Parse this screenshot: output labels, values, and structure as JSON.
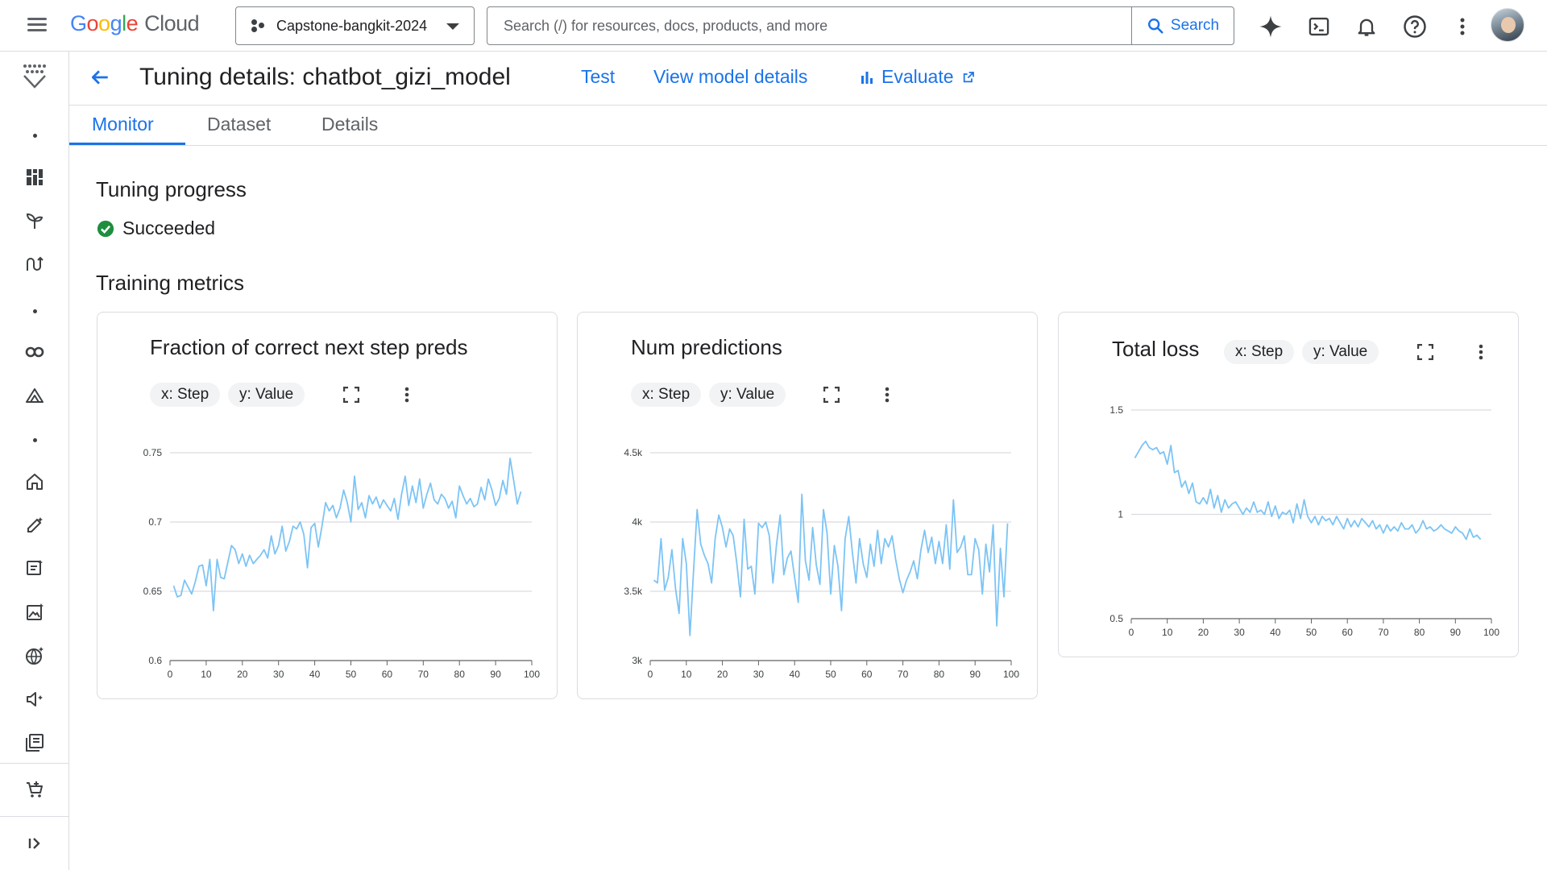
{
  "header": {
    "logo": {
      "google": "Google",
      "cloud": "Cloud"
    },
    "project": "Capstone-bangkit-2024",
    "search_placeholder": "Search (/) for resources, docs, products, and more",
    "search_button": "Search"
  },
  "page": {
    "title": "Tuning details: chatbot_gizi_model",
    "links": {
      "test": "Test",
      "view_model": "View model details",
      "evaluate": "Evaluate"
    },
    "tabs": [
      "Monitor",
      "Dataset",
      "Details"
    ],
    "active_tab": "Monitor"
  },
  "progress": {
    "heading": "Tuning progress",
    "status": "Succeeded",
    "status_color": "#1e8e3e"
  },
  "metrics": {
    "heading": "Training metrics"
  },
  "colors": {
    "accent": "#1a73e8",
    "line": "#7cc4f5",
    "grid": "#dadce0"
  },
  "chart_data": [
    {
      "type": "line",
      "title": "Fraction of correct next step preds",
      "chip_x": "x: Step",
      "chip_y": "y: Value",
      "xlim": [
        0,
        100
      ],
      "ylim": [
        0.6,
        0.75
      ],
      "x_ticks": [
        0,
        10,
        20,
        30,
        40,
        50,
        60,
        70,
        80,
        90,
        100
      ],
      "y_ticks": [
        0.6,
        0.65,
        0.7,
        0.75
      ],
      "y_tick_labels": [
        "0.6",
        "0.65",
        "0.7",
        "0.75"
      ],
      "x": [
        1,
        2,
        3,
        4,
        5,
        6,
        7,
        8,
        9,
        10,
        11,
        12,
        13,
        14,
        15,
        16,
        17,
        18,
        19,
        20,
        21,
        22,
        23,
        24,
        25,
        26,
        27,
        28,
        29,
        30,
        31,
        32,
        33,
        34,
        35,
        36,
        37,
        38,
        39,
        40,
        41,
        42,
        43,
        44,
        45,
        46,
        47,
        48,
        49,
        50,
        51,
        52,
        53,
        54,
        55,
        56,
        57,
        58,
        59,
        60,
        61,
        62,
        63,
        64,
        65,
        66,
        67,
        68,
        69,
        70,
        71,
        72,
        73,
        74,
        75,
        76,
        77,
        78,
        79,
        80,
        81,
        82,
        83,
        84,
        85,
        86,
        87,
        88,
        89,
        90,
        91,
        92,
        93,
        94,
        95,
        96,
        97
      ],
      "y": [
        0.654,
        0.646,
        0.647,
        0.658,
        0.653,
        0.648,
        0.657,
        0.668,
        0.669,
        0.654,
        0.673,
        0.636,
        0.673,
        0.66,
        0.659,
        0.671,
        0.683,
        0.68,
        0.67,
        0.677,
        0.668,
        0.676,
        0.67,
        0.673,
        0.676,
        0.68,
        0.674,
        0.69,
        0.677,
        0.683,
        0.697,
        0.679,
        0.686,
        0.697,
        0.695,
        0.7,
        0.691,
        0.667,
        0.696,
        0.699,
        0.682,
        0.697,
        0.714,
        0.708,
        0.712,
        0.703,
        0.71,
        0.723,
        0.714,
        0.7,
        0.733,
        0.709,
        0.714,
        0.703,
        0.719,
        0.713,
        0.718,
        0.71,
        0.716,
        0.712,
        0.708,
        0.717,
        0.702,
        0.72,
        0.733,
        0.712,
        0.726,
        0.714,
        0.731,
        0.71,
        0.72,
        0.728,
        0.716,
        0.713,
        0.72,
        0.717,
        0.71,
        0.715,
        0.703,
        0.726,
        0.719,
        0.713,
        0.717,
        0.711,
        0.713,
        0.725,
        0.716,
        0.731,
        0.723,
        0.712,
        0.717,
        0.73,
        0.72,
        0.746,
        0.73,
        0.713,
        0.722
      ]
    },
    {
      "type": "line",
      "title": "Num predictions",
      "chip_x": "x: Step",
      "chip_y": "y: Value",
      "xlim": [
        0,
        100
      ],
      "ylim": [
        3000,
        4500
      ],
      "x_ticks": [
        0,
        10,
        20,
        30,
        40,
        50,
        60,
        70,
        80,
        90,
        100
      ],
      "y_ticks": [
        3000,
        3500,
        4000,
        4500
      ],
      "y_tick_labels": [
        "3k",
        "3.5k",
        "4k",
        "4.5k"
      ],
      "x": [
        1,
        2,
        3,
        4,
        5,
        6,
        7,
        8,
        9,
        10,
        11,
        12,
        13,
        14,
        15,
        16,
        17,
        18,
        19,
        20,
        21,
        22,
        23,
        24,
        25,
        26,
        27,
        28,
        29,
        30,
        31,
        32,
        33,
        34,
        35,
        36,
        37,
        38,
        39,
        40,
        41,
        42,
        43,
        44,
        45,
        46,
        47,
        48,
        49,
        50,
        51,
        52,
        53,
        54,
        55,
        56,
        57,
        58,
        59,
        60,
        61,
        62,
        63,
        64,
        65,
        66,
        67,
        68,
        69,
        70,
        71,
        72,
        73,
        74,
        75,
        76,
        77,
        78,
        79,
        80,
        81,
        82,
        83,
        84,
        85,
        86,
        87,
        88,
        89,
        90,
        91,
        92,
        93,
        94,
        95,
        96,
        97,
        98,
        99
      ],
      "y": [
        3580,
        3560,
        3880,
        3510,
        3600,
        3800,
        3520,
        3340,
        3880,
        3700,
        3180,
        3650,
        4090,
        3840,
        3760,
        3700,
        3560,
        3880,
        4050,
        3960,
        3820,
        3950,
        3900,
        3700,
        3460,
        4020,
        3660,
        3680,
        3480,
        3990,
        3960,
        4000,
        3900,
        3560,
        3840,
        4050,
        3620,
        3740,
        3790,
        3600,
        3420,
        4200,
        3720,
        3580,
        3960,
        3690,
        3550,
        4090,
        3920,
        3480,
        3830,
        3680,
        3360,
        3880,
        4040,
        3780,
        3560,
        3880,
        3700,
        3600,
        3840,
        3680,
        3940,
        3700,
        3880,
        3820,
        3900,
        3730,
        3590,
        3490,
        3580,
        3640,
        3720,
        3590,
        3800,
        3940,
        3780,
        3890,
        3700,
        3860,
        3700,
        3980,
        3660,
        4160,
        3780,
        3820,
        3900,
        3620,
        3620,
        3880,
        3800,
        3480,
        3840,
        3640,
        3980,
        3250,
        3810,
        3460,
        3990,
        3770,
        3560
      ]
    },
    {
      "type": "line",
      "title": "Total loss",
      "chip_x": "x: Step",
      "chip_y": "y: Value",
      "xlim": [
        0,
        100
      ],
      "ylim": [
        0.5,
        1.5
      ],
      "x_ticks": [
        0,
        10,
        20,
        30,
        40,
        50,
        60,
        70,
        80,
        90,
        100
      ],
      "y_ticks": [
        0.5,
        1,
        1.5
      ],
      "y_tick_labels": [
        "0.5",
        "1",
        "1.5"
      ],
      "x": [
        1,
        2,
        3,
        4,
        5,
        6,
        7,
        8,
        9,
        10,
        11,
        12,
        13,
        14,
        15,
        16,
        17,
        18,
        19,
        20,
        21,
        22,
        23,
        24,
        25,
        26,
        27,
        28,
        29,
        30,
        31,
        32,
        33,
        34,
        35,
        36,
        37,
        38,
        39,
        40,
        41,
        42,
        43,
        44,
        45,
        46,
        47,
        48,
        49,
        50,
        51,
        52,
        53,
        54,
        55,
        56,
        57,
        58,
        59,
        60,
        61,
        62,
        63,
        64,
        65,
        66,
        67,
        68,
        69,
        70,
        71,
        72,
        73,
        74,
        75,
        76,
        77,
        78,
        79,
        80,
        81,
        82,
        83,
        84,
        85,
        86,
        87,
        88,
        89,
        90,
        91,
        92,
        93,
        94,
        95,
        96,
        97
      ],
      "y": [
        1.27,
        1.3,
        1.33,
        1.35,
        1.32,
        1.31,
        1.32,
        1.29,
        1.3,
        1.24,
        1.33,
        1.2,
        1.21,
        1.13,
        1.16,
        1.1,
        1.15,
        1.06,
        1.05,
        1.08,
        1.05,
        1.12,
        1.03,
        1.09,
        1.01,
        1.07,
        1.03,
        1.05,
        1.06,
        1.03,
        1.0,
        1.03,
        1.01,
        1.06,
        1.01,
        1.02,
        1.0,
        1.06,
        0.99,
        1.04,
        0.98,
        1.01,
        1.0,
        1.02,
        0.96,
        1.05,
        0.98,
        1.07,
        0.99,
        0.96,
        0.99,
        0.95,
        0.99,
        0.97,
        0.98,
        0.95,
        0.99,
        0.96,
        0.93,
        0.98,
        0.94,
        0.97,
        0.94,
        0.98,
        0.96,
        0.94,
        0.97,
        0.93,
        0.95,
        0.91,
        0.95,
        0.92,
        0.94,
        0.92,
        0.96,
        0.93,
        0.93,
        0.95,
        0.91,
        0.93,
        0.97,
        0.93,
        0.94,
        0.92,
        0.93,
        0.95,
        0.93,
        0.92,
        0.91,
        0.94,
        0.92,
        0.91,
        0.88,
        0.93,
        0.89,
        0.9,
        0.88
      ]
    }
  ]
}
